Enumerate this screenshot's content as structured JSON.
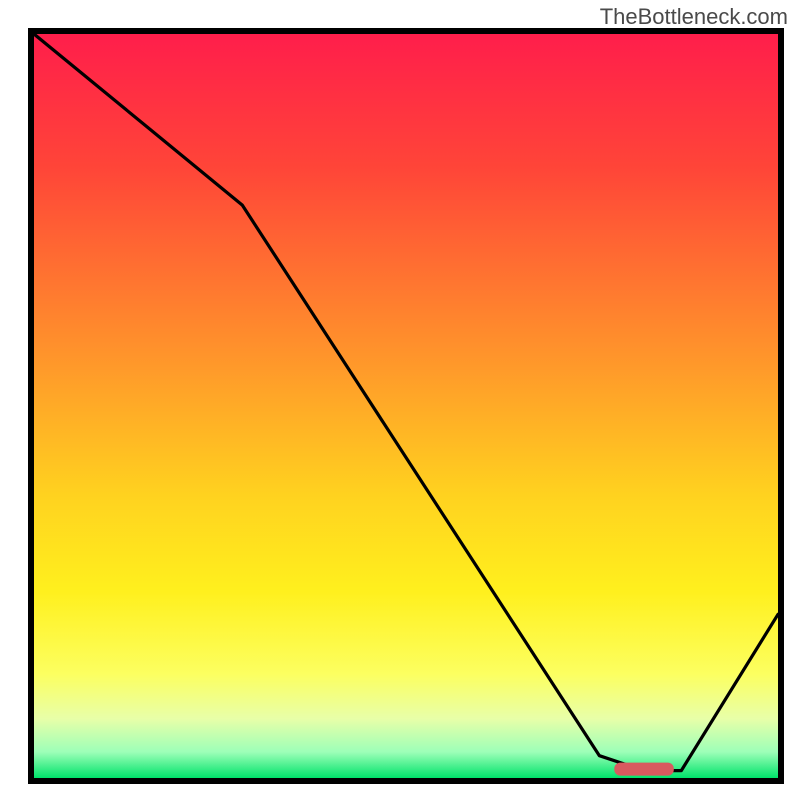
{
  "watermark": "TheBottleneck.com",
  "chart_data": {
    "type": "line",
    "title": "",
    "xlabel": "",
    "ylabel": "",
    "xlim": [
      0,
      100
    ],
    "ylim": [
      0,
      100
    ],
    "grid": false,
    "legend": false,
    "series": [
      {
        "name": "bottleneck-curve",
        "x": [
          0,
          28,
          76,
          82,
          87,
          100
        ],
        "y": [
          100,
          77,
          3,
          1,
          1,
          22
        ]
      }
    ],
    "optimal_marker": {
      "x_start": 78,
      "x_end": 86,
      "y": 1.2
    },
    "background_gradient": {
      "stops": [
        {
          "pos": 0.0,
          "color": "#ff1e4b"
        },
        {
          "pos": 0.18,
          "color": "#ff4538"
        },
        {
          "pos": 0.45,
          "color": "#ff9a2a"
        },
        {
          "pos": 0.62,
          "color": "#ffd21f"
        },
        {
          "pos": 0.75,
          "color": "#fff01e"
        },
        {
          "pos": 0.86,
          "color": "#fcff60"
        },
        {
          "pos": 0.92,
          "color": "#e8ffa8"
        },
        {
          "pos": 0.965,
          "color": "#9dffb8"
        },
        {
          "pos": 1.0,
          "color": "#00e36a"
        }
      ]
    },
    "marker_color": "#d85a5f"
  }
}
